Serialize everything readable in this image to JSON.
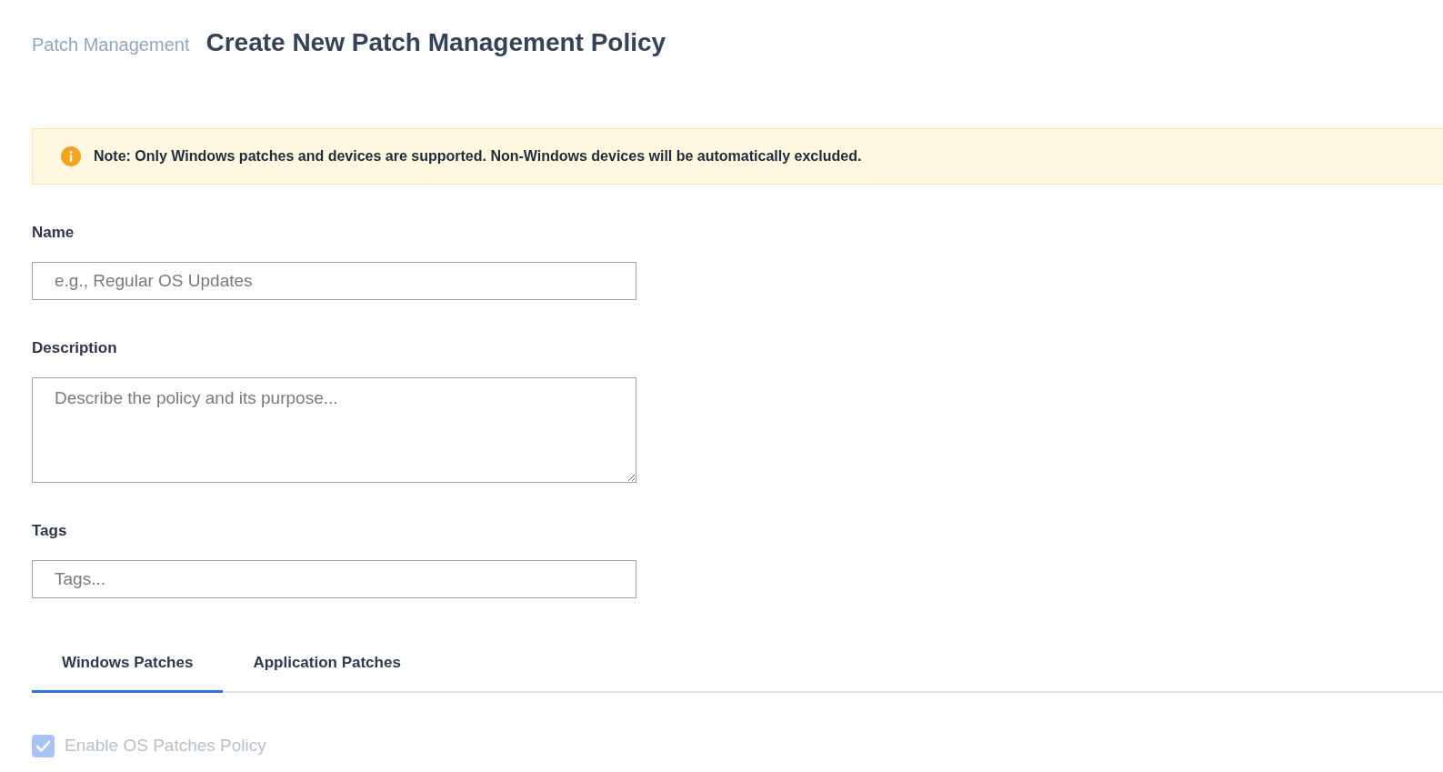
{
  "breadcrumb": "Patch Management",
  "title": "Create New Patch Management Policy",
  "alert": {
    "text": "Note: Only Windows patches and devices are supported. Non-Windows devices will be automatically excluded."
  },
  "fields": [
    {
      "kind": "input",
      "label": "Name",
      "placeholder": "e.g., Regular OS Updates"
    },
    {
      "kind": "textarea",
      "label": "Description",
      "placeholder": "Describe the policy and its purpose..."
    },
    {
      "kind": "input",
      "label": "Tags",
      "placeholder": "Tags..."
    }
  ],
  "tabs": [
    {
      "label": "Windows Patches",
      "selected": true
    },
    {
      "label": "Application Patches",
      "selected": false
    }
  ],
  "checkbox": {
    "label": "Enable OS Patches Policy",
    "checked": true,
    "disabled": true
  }
}
